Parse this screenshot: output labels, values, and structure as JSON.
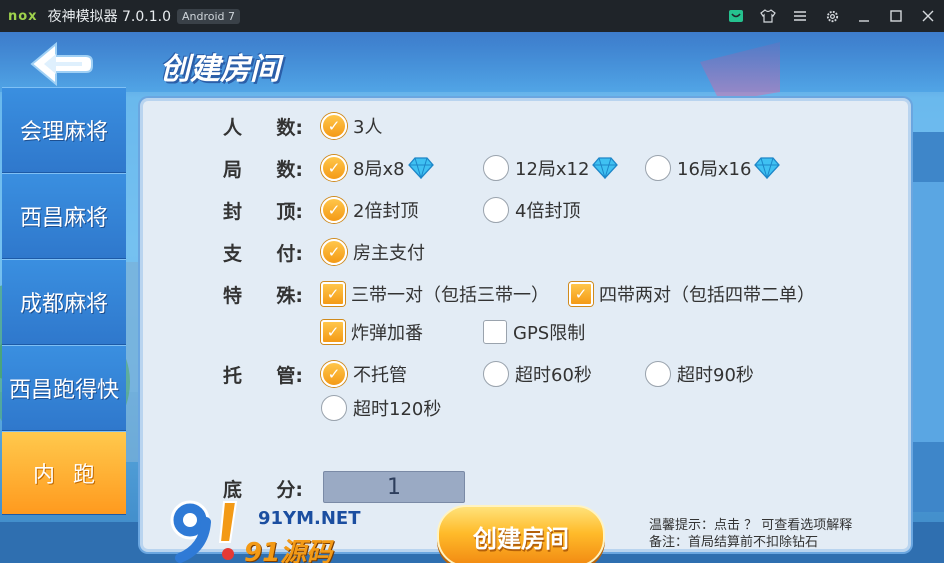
{
  "titlebar": {
    "logo": "nox",
    "title": "夜神模拟器 7.0.1.0",
    "badge": "Android 7",
    "icons": [
      "store-icon",
      "shirt-icon",
      "menu-icon",
      "gear-icon",
      "minimize-icon",
      "maximize-icon",
      "close-icon"
    ]
  },
  "header": {
    "title": "创建房间"
  },
  "sidebar": {
    "items": [
      {
        "label": "会理麻将",
        "active": false
      },
      {
        "label": "西昌麻将",
        "active": false
      },
      {
        "label": "成都麻将",
        "active": false
      },
      {
        "label": "西昌跑得快",
        "active": false
      },
      {
        "label": "内跑",
        "active": true
      }
    ]
  },
  "form": {
    "players": {
      "label_a": "人",
      "label_b": "数:",
      "options": [
        {
          "text": "3人",
          "selected": true
        }
      ]
    },
    "rounds": {
      "label_a": "局",
      "label_b": "数:",
      "options": [
        {
          "text": "8局x8",
          "selected": false,
          "gem": true
        },
        {
          "text": "12局x12",
          "selected": false,
          "gem": true
        },
        {
          "text": "16局x16",
          "selected": false,
          "gem": true
        }
      ],
      "selected_index": 0
    },
    "cap": {
      "label_a": "封",
      "label_b": "顶:",
      "options": [
        {
          "text": "2倍封顶",
          "selected": true
        },
        {
          "text": "4倍封顶",
          "selected": false
        }
      ]
    },
    "pay": {
      "label_a": "支",
      "label_b": "付:",
      "options": [
        {
          "text": "房主支付",
          "selected": true
        }
      ]
    },
    "special": {
      "label_a": "特",
      "label_b": "殊:",
      "options": [
        {
          "text": "三带一对（包括三带一）",
          "checked": true
        },
        {
          "text": "四带两对（包括四带二单）",
          "checked": true
        },
        {
          "text": "炸弹加番",
          "checked": true
        },
        {
          "text": "GPS限制",
          "checked": false
        }
      ]
    },
    "trustee": {
      "label_a": "托",
      "label_b": "管:",
      "options": [
        {
          "text": "不托管",
          "selected": true
        },
        {
          "text": "超时60秒",
          "selected": false
        },
        {
          "text": "超时90秒",
          "selected": false
        },
        {
          "text": "超时120秒",
          "selected": false
        }
      ]
    },
    "base_score": {
      "label_a": "底",
      "label_b": "分:",
      "value": "1"
    }
  },
  "create_button": "创建房间",
  "tips": {
    "line1": "温馨提示：点击 ？ 可查看选项解释",
    "line2": "备注：首局结算前不扣除钻石"
  },
  "watermark": {
    "text1": "91YM.NET",
    "text2": "91源码"
  },
  "colors": {
    "accent_orange": "#f49a16",
    "panel_bg": "#e3ecf5",
    "sidebar_blue": "#2f78cc",
    "titlebar_bg": "#1f2429"
  }
}
